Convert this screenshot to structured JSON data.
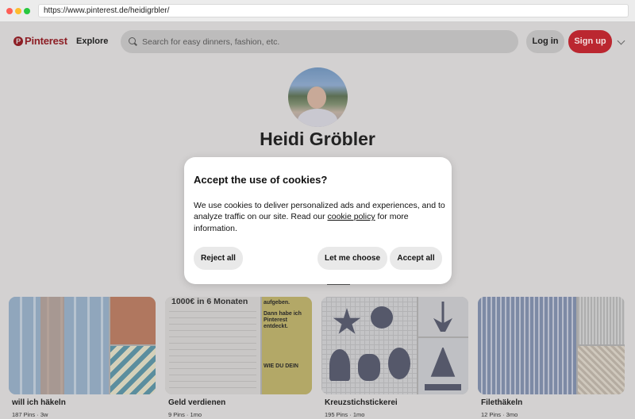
{
  "browser": {
    "url": "https://www.pinterest.de/heidigrbler/"
  },
  "header": {
    "logo_mark": "P",
    "logo_text": "Pinterest",
    "explore_label": "Explore",
    "search_placeholder": "Search for easy dinners, fashion, etc.",
    "login_label": "Log in",
    "signup_label": "Sign up"
  },
  "profile": {
    "name": "Heidi Gröbler"
  },
  "boards": [
    {
      "title": "will ich häkeln",
      "meta": "187 Pins · 3w"
    },
    {
      "title": "Geld verdienen",
      "meta": "9 Pins · 1mo",
      "cover_headline": "1000€ in 6 Monaten",
      "cover_side_lines": [
        "aufgeben.",
        "Dann habe ich",
        "Pinterest",
        "entdeckt.",
        "WIE DU DEIN"
      ]
    },
    {
      "title": "Kreuzstichstickerei",
      "meta": "195 Pins · 1mo"
    },
    {
      "title": "Filethäkeln",
      "meta": "12 Pins · 3mo"
    }
  ],
  "cookie_modal": {
    "title": "Accept the use of cookies?",
    "body_before_link": "We use cookies to deliver personalized ads and experiences, and to analyze traffic on our site. Read our ",
    "link_text": "cookie policy",
    "body_after_link": " for more information.",
    "reject_label": "Reject all",
    "choose_label": "Let me choose",
    "accept_label": "Accept all"
  },
  "colors": {
    "brand_red": "#e60023",
    "overlay_gray": "#d3d1d1"
  }
}
